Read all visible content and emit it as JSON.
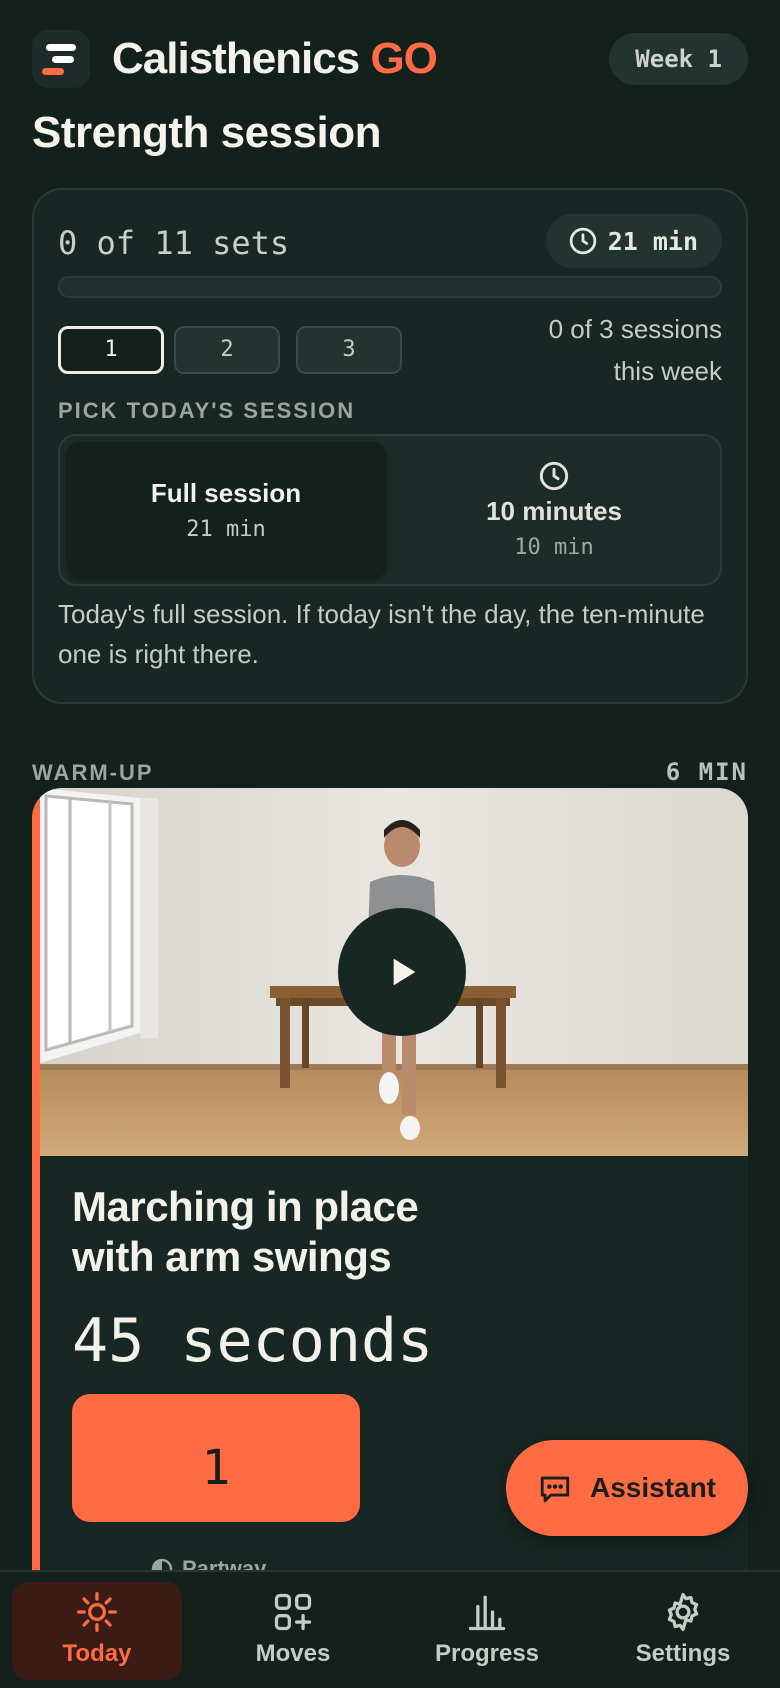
{
  "header": {
    "app_name_main": "Calisthenics",
    "app_name_accent": "GO",
    "week_label": "Week 1",
    "logo_icon": "menu-lines-logo"
  },
  "page_title": "Strength session",
  "session_card": {
    "sets_text": "0 of 11 sets",
    "total_time": "21 min",
    "progress_fraction": 0,
    "tabs": [
      "1",
      "2",
      "3"
    ],
    "active_tab": "1",
    "sessions_week_line1": "0 of 3 sessions",
    "sessions_week_line2": "this week",
    "pick_label": "PICK TODAY'S SESSION",
    "options": [
      {
        "title": "Full session",
        "subtitle": "21 min",
        "selected": true
      },
      {
        "title": "10 minutes",
        "subtitle": "10 min",
        "selected": false,
        "icon": "clock-icon"
      }
    ],
    "note": "Today's full session. If today isn't the day, the ten-minute one is right there."
  },
  "warmup": {
    "label": "WARM-UP",
    "duration": "6 MIN",
    "exercise_title_line1": "Marching in place",
    "exercise_title_line2": "with arm swings",
    "exercise_duration": "45 seconds",
    "counter_value": "1",
    "partway_label": "Partway"
  },
  "assistant_button": {
    "label": "Assistant",
    "icon": "chat-icon"
  },
  "bottom_nav": [
    {
      "label": "Today",
      "icon": "sun-icon",
      "active": true
    },
    {
      "label": "Moves",
      "icon": "grid-plus-icon",
      "active": false
    },
    {
      "label": "Progress",
      "icon": "bar-chart-icon",
      "active": false
    },
    {
      "label": "Settings",
      "icon": "gear-icon",
      "active": false
    }
  ],
  "colors": {
    "background": "#13201c",
    "card": "#182723",
    "accent": "#ff6b42",
    "text": "#ecebe3"
  }
}
